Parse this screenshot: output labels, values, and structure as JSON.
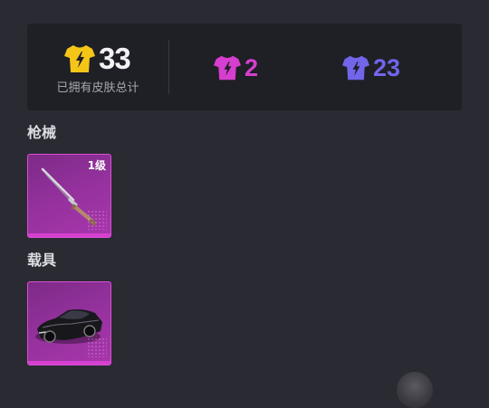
{
  "summary": {
    "total_count": "33",
    "total_label": "已拥有皮肤总计",
    "pink_count": "2",
    "purple_count": "23",
    "colors": {
      "gold": "#f5c518",
      "pink": "#d63ecf",
      "purple": "#7265e9"
    }
  },
  "sections": {
    "weapons_title": "枪械",
    "vehicles_title": "载具"
  },
  "cards": {
    "gun": {
      "level": "1级",
      "icon": "rifle-icon"
    },
    "car": {
      "icon": "sports-car-icon"
    }
  }
}
